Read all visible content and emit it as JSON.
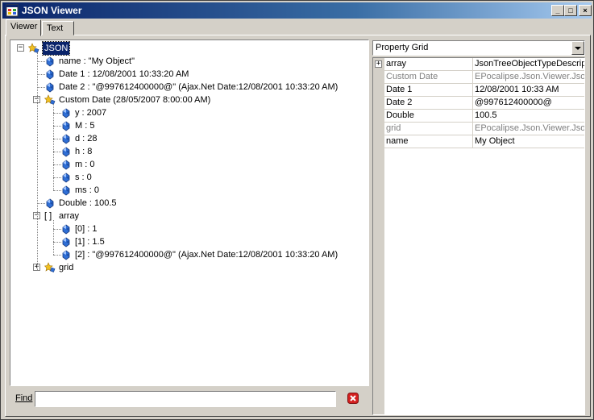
{
  "window": {
    "title": "JSON Viewer"
  },
  "title_controls": {
    "minimize": "_",
    "maximize": "□",
    "close": "×"
  },
  "tabs": [
    "Viewer",
    "Text"
  ],
  "tree": {
    "root": "JSON",
    "nodes": [
      {
        "label": "name : \"My Object\""
      },
      {
        "label": "Date 1 : 12/08/2001 10:33:20 AM"
      },
      {
        "label": "Date 2 : \"@997612400000@\" (Ajax.Net Date:12/08/2001 10:33:20 AM)"
      },
      {
        "label": "Custom Date (28/05/2007 8:00:00 AM)",
        "expander": "−",
        "children": [
          "y : 2007",
          "M : 5",
          "d : 28",
          "h : 8",
          "m : 0",
          "s : 0",
          "ms : 0"
        ]
      },
      {
        "label": "Double : 100.5"
      },
      {
        "label": "array",
        "expander": "−",
        "icon_text": "[ ]",
        "children": [
          "[0] : 1",
          "[1] : 1.5",
          "[2] : \"@997612400000@\" (Ajax.Net Date:12/08/2001 10:33:20 AM)"
        ]
      },
      {
        "label": "grid",
        "expander": "+"
      }
    ],
    "root_expander": "−"
  },
  "find": {
    "label": "Find",
    "value": ""
  },
  "property_panel": {
    "selector": "Property Grid",
    "rows": [
      {
        "name": "array",
        "value": "JsonTreeObjectTypeDescriptor",
        "expander": "+",
        "dim": false
      },
      {
        "name": "Custom Date",
        "value": "EPocalipse.Json.Viewer.JsonTreeObject",
        "dim": true
      },
      {
        "name": "Date 1",
        "value": "12/08/2001 10:33 AM",
        "dim": false
      },
      {
        "name": "Date 2",
        "value": "@997612400000@",
        "dim": false
      },
      {
        "name": "Double",
        "value": "100.5",
        "dim": false
      },
      {
        "name": "grid",
        "value": "EPocalipse.Json.Viewer.JsonTreeObject",
        "dim": true
      },
      {
        "name": "name",
        "value": "My Object",
        "dim": false
      }
    ]
  },
  "icons": {
    "app": "app-window-icon",
    "object_node": "json-object-icon",
    "value_node": "blue-gem-icon",
    "array_node": "array-brackets-icon",
    "clear": "red-x-clear-icon"
  },
  "colors": {
    "title_start": "#0a246a",
    "title_end": "#a6caf0",
    "selection": "#0a246a",
    "value_gem": "#2f6fd6",
    "clear_red": "#d42020",
    "face": "#d4d0c8"
  }
}
